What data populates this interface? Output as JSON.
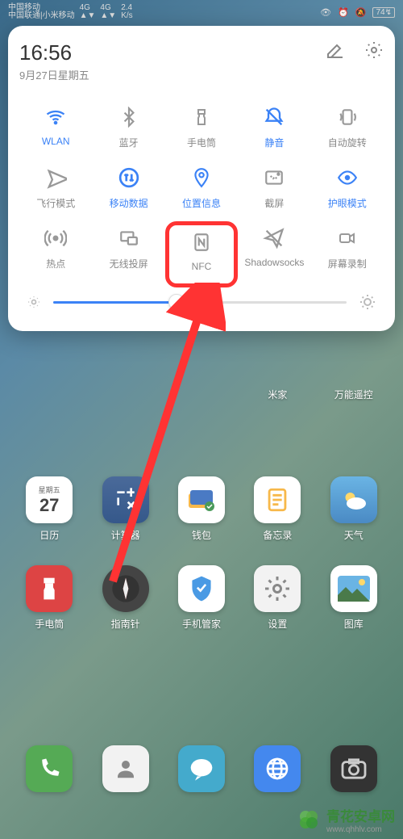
{
  "statusbar": {
    "carriers": [
      "中国移动",
      "中国联通|小米移动"
    ],
    "net1": "4G",
    "net2": "4G",
    "speed": "2.4",
    "speed_unit": "K/s",
    "battery": "74"
  },
  "panel": {
    "time": "16:56",
    "date": "9月27日星期五",
    "toggles": [
      {
        "label": "WLAN",
        "icon": "wifi",
        "active": true
      },
      {
        "label": "蓝牙",
        "icon": "bluetooth",
        "active": false
      },
      {
        "label": "手电筒",
        "icon": "flashlight",
        "active": false
      },
      {
        "label": "静音",
        "icon": "mute",
        "active": true
      },
      {
        "label": "自动旋转",
        "icon": "rotate",
        "active": false
      },
      {
        "label": "飞行模式",
        "icon": "airplane",
        "active": false
      },
      {
        "label": "移动数据",
        "icon": "data",
        "active": true
      },
      {
        "label": "位置信息",
        "icon": "location",
        "active": true
      },
      {
        "label": "截屏",
        "icon": "screenshot",
        "active": false
      },
      {
        "label": "护眼模式",
        "icon": "eyecare",
        "active": true
      },
      {
        "label": "热点",
        "icon": "hotspot",
        "active": false
      },
      {
        "label": "无线投屏",
        "icon": "cast",
        "active": false
      },
      {
        "label": "NFC",
        "icon": "nfc",
        "active": false,
        "highlight": true
      },
      {
        "label": "Shadowsocks",
        "icon": "send",
        "active": false
      },
      {
        "label": "屏幕录制",
        "icon": "record",
        "active": false
      }
    ],
    "brightness_pct": 42
  },
  "home": {
    "row_partial": [
      {
        "label": "米家"
      },
      {
        "label": "万能遥控"
      }
    ],
    "row2": [
      {
        "label": "日历",
        "icon": "calendar",
        "day": "27",
        "week": "星期五"
      },
      {
        "label": "计算器",
        "icon": "calc"
      },
      {
        "label": "钱包",
        "icon": "wallet"
      },
      {
        "label": "备忘录",
        "icon": "notes"
      },
      {
        "label": "天气",
        "icon": "weather"
      }
    ],
    "row3": [
      {
        "label": "手电筒",
        "icon": "torch-app"
      },
      {
        "label": "指南针",
        "icon": "compass"
      },
      {
        "label": "手机管家",
        "icon": "security"
      },
      {
        "label": "设置",
        "icon": "settings"
      },
      {
        "label": "图库",
        "icon": "gallery"
      }
    ],
    "dock": [
      {
        "icon": "phone"
      },
      {
        "icon": "contacts"
      },
      {
        "icon": "message"
      },
      {
        "icon": "browser"
      },
      {
        "icon": "camera"
      }
    ]
  },
  "watermark": {
    "title": "青花安卓网",
    "url": "www.qhhlv.com"
  }
}
